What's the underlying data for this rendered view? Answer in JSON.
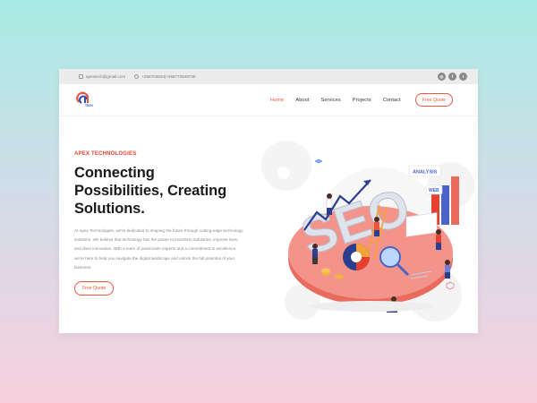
{
  "topbar": {
    "email": "apextech@gmail.com",
    "phone": "+256703934|+256770849739",
    "socials": [
      {
        "icon": "instagram-icon",
        "glyph": "◎"
      },
      {
        "icon": "facebook-icon",
        "glyph": "f"
      },
      {
        "icon": "twitter-icon",
        "glyph": "t"
      }
    ]
  },
  "nav": {
    "logo_text": "TECH",
    "items": [
      "Home",
      "About",
      "Services",
      "Projects",
      "Contact"
    ],
    "active": "Home",
    "cta": "Free Quote"
  },
  "hero": {
    "eyebrow": "APEX TECHNOLOGIES",
    "headline_1": "Connecting",
    "headline_2": "Possibilities, Creating",
    "headline_3": "Solutions.",
    "description": "At Apex Technologies, we're dedicated to shaping the future through cutting-edge technology solutions. We believe that technology has the power to transform industries, improve lives, and drive innovation. With a team of passionate experts and a commitment to excellence, we're here to help you navigate the digital landscape and unlock the full potential of your business.",
    "cta": "Free Quote"
  },
  "illustration": {
    "big_text": "SEO",
    "tag_analysis": "ANALYSIS",
    "tag_web": "WEB"
  },
  "colors": {
    "accent": "#f0553c",
    "platform": "#f08a80",
    "blue": "#4a63c9",
    "dark": "#1a1a1a"
  }
}
